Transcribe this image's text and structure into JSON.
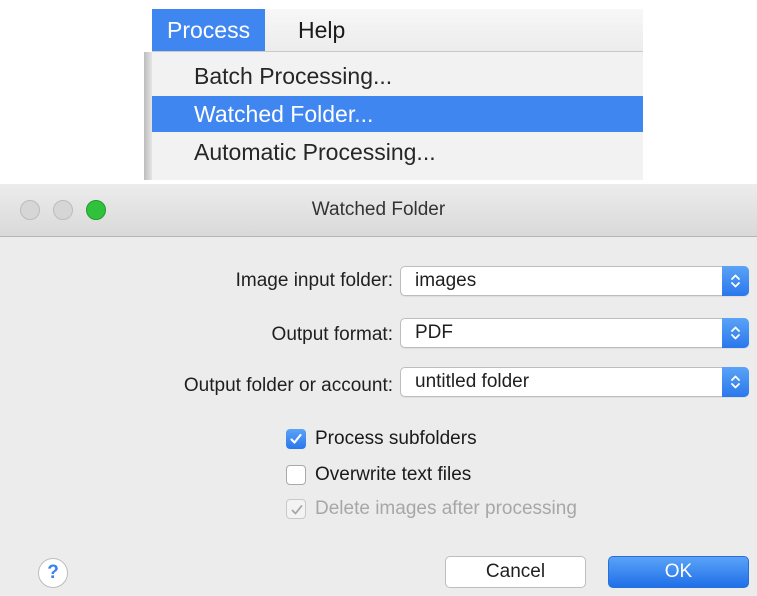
{
  "menubar": {
    "items": [
      {
        "label": "Process",
        "active": true
      },
      {
        "label": "Help",
        "active": false
      }
    ]
  },
  "process_menu": {
    "items": [
      {
        "label": "Batch Processing...",
        "highlighted": false
      },
      {
        "label": "Watched Folder...",
        "highlighted": true
      },
      {
        "label": "Automatic Processing...",
        "highlighted": false
      }
    ]
  },
  "window": {
    "title": "Watched Folder",
    "fields": {
      "input_folder": {
        "label": "Image input folder:",
        "value": "images"
      },
      "output_format": {
        "label": "Output format:",
        "value": "PDF"
      },
      "output_folder": {
        "label": "Output folder or account:",
        "value": "untitled folder"
      }
    },
    "checkboxes": [
      {
        "label": "Process subfolders",
        "checked": true,
        "enabled": true
      },
      {
        "label": "Overwrite text files",
        "checked": false,
        "enabled": true
      },
      {
        "label": "Delete images after processing",
        "checked": true,
        "enabled": false
      }
    ],
    "buttons": {
      "help": "?",
      "cancel": "Cancel",
      "ok": "OK"
    }
  },
  "colors": {
    "accent": "#3f86f0",
    "traffic_zoom": "#2fc23a",
    "window_bg": "#ececec"
  },
  "icons": {
    "select_arrows": "up-down-chevron-icon",
    "checkmark": "checkmark-icon"
  }
}
